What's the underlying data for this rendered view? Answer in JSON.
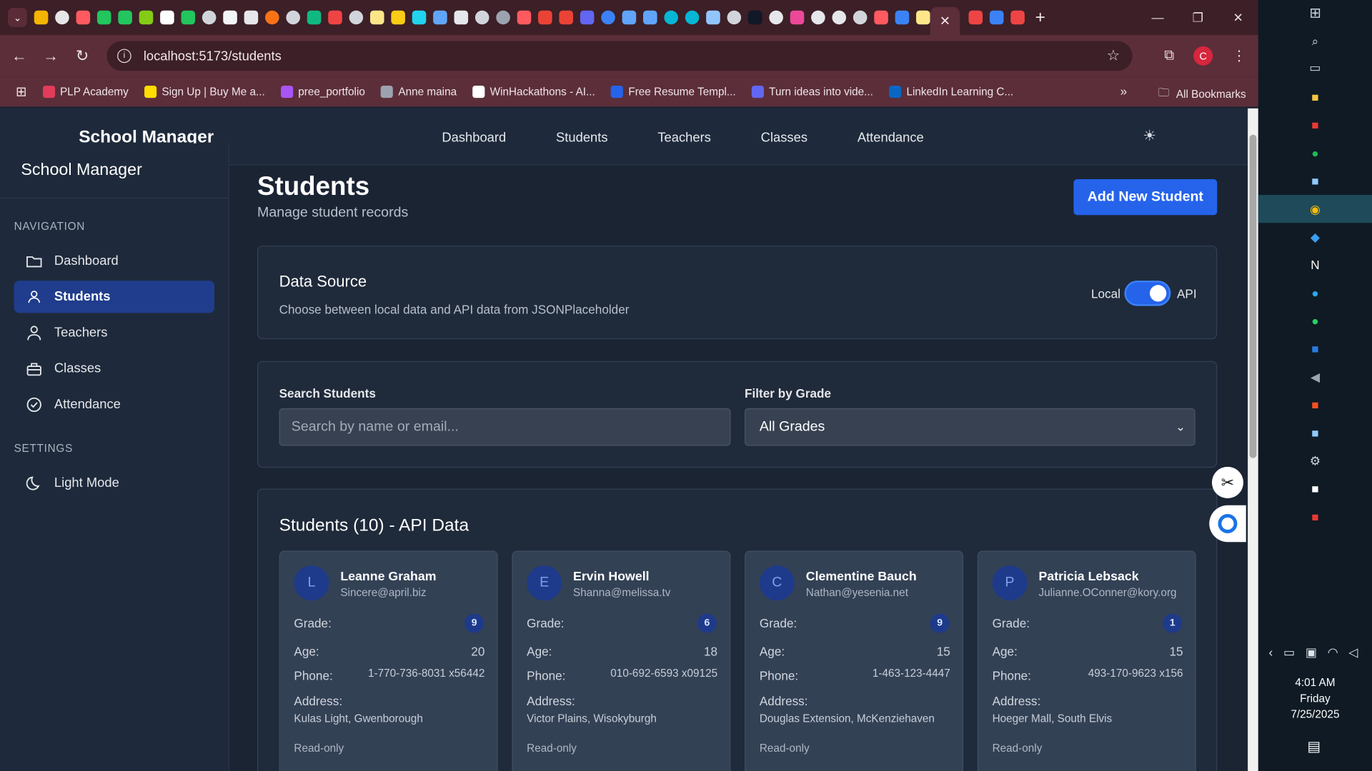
{
  "browser": {
    "url": "localhost:5173/students",
    "profile_initial": "C",
    "bookmarks": [
      {
        "label": "PLP Academy",
        "color": "#e23b5b"
      },
      {
        "label": "Sign Up | Buy Me a...",
        "color": "#ffdd00"
      },
      {
        "label": "pree_portfolio",
        "color": "#a855f7"
      },
      {
        "label": "Anne maina",
        "color": "#9ca3af"
      },
      {
        "label": "WinHackathons - AI...",
        "color": "#ffffff"
      },
      {
        "label": "Free Resume Templ...",
        "color": "#2563eb"
      },
      {
        "label": "Turn ideas into vide...",
        "color": "#6366f1"
      },
      {
        "label": "LinkedIn Learning C...",
        "color": "#0a66c2"
      }
    ],
    "all_bookmarks": "All Bookmarks"
  },
  "topnav": {
    "brand": "School Manager",
    "links": [
      "Dashboard",
      "Students",
      "Teachers",
      "Classes",
      "Attendance"
    ]
  },
  "sidebar": {
    "title": "School Manager",
    "nav_label": "NAVIGATION",
    "items": [
      {
        "label": "Dashboard",
        "icon": "folder-icon"
      },
      {
        "label": "Students",
        "icon": "users-icon"
      },
      {
        "label": "Teachers",
        "icon": "user-icon"
      },
      {
        "label": "Classes",
        "icon": "briefcase-icon"
      },
      {
        "label": "Attendance",
        "icon": "check-circle-icon"
      }
    ],
    "settings_label": "SETTINGS",
    "light_mode": "Light Mode"
  },
  "page": {
    "title": "Students",
    "subtitle": "Manage student records",
    "add_button": "Add New Student"
  },
  "data_source": {
    "title": "Data Source",
    "description": "Choose between local data and API data from JSONPlaceholder",
    "local_label": "Local",
    "api_label": "API",
    "api_enabled": true
  },
  "filters": {
    "search_label": "Search Students",
    "search_placeholder": "Search by name or email...",
    "grade_label": "Filter by Grade",
    "grade_value": "All Grades"
  },
  "list": {
    "title": "Students (10) - API Data",
    "labels": {
      "grade": "Grade:",
      "age": "Age:",
      "phone": "Phone:",
      "address": "Address:",
      "readonly": "Read-only"
    },
    "students": [
      {
        "initial": "L",
        "name": "Leanne Graham",
        "email": "Sincere@april.biz",
        "grade": "9",
        "age": "20",
        "phone": "1-770-736-8031 x56442",
        "address": "Kulas Light, Gwenborough"
      },
      {
        "initial": "E",
        "name": "Ervin Howell",
        "email": "Shanna@melissa.tv",
        "grade": "6",
        "age": "18",
        "phone": "010-692-6593 x09125",
        "address": "Victor Plains, Wisokyburgh"
      },
      {
        "initial": "C",
        "name": "Clementine Bauch",
        "email": "Nathan@yesenia.net",
        "grade": "9",
        "age": "15",
        "phone": "1-463-123-4447",
        "address": "Douglas Extension, McKenziehaven"
      },
      {
        "initial": "P",
        "name": "Patricia Lebsack",
        "email": "Julianne.OConner@kory.org",
        "grade": "1",
        "age": "15",
        "phone": "493-170-9623 x156",
        "address": "Hoeger Mall, South Elvis"
      }
    ]
  },
  "taskbar": {
    "time": "4:01 AM",
    "day": "Friday",
    "date": "7/25/2025"
  }
}
